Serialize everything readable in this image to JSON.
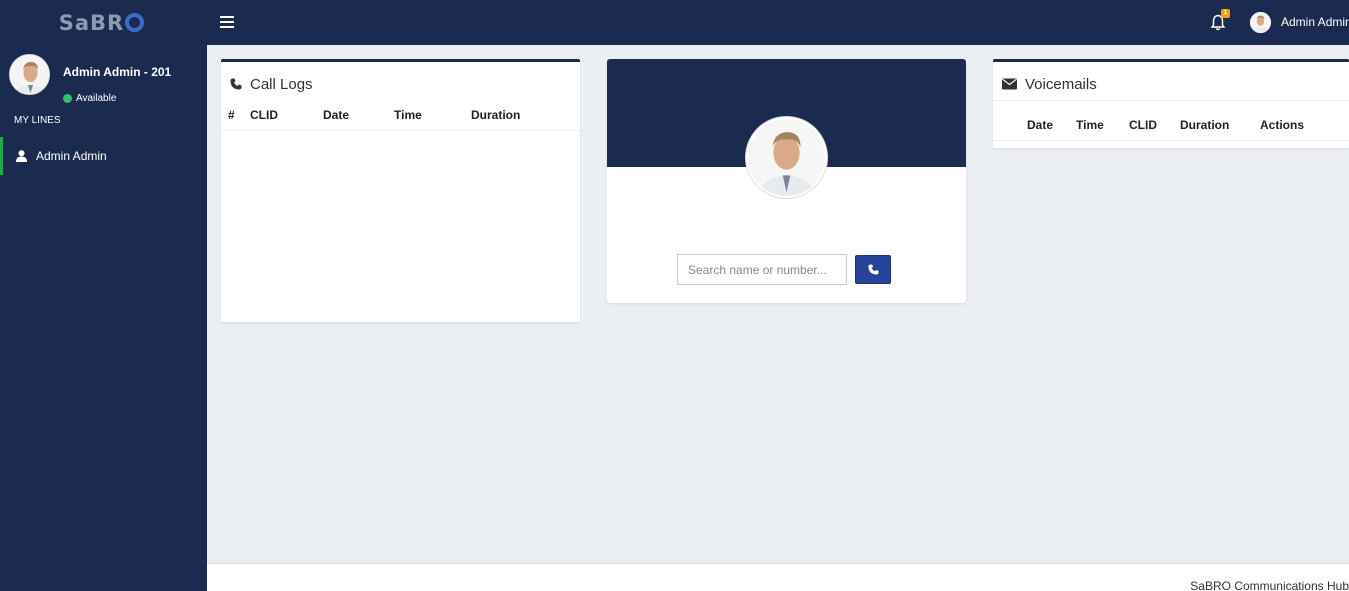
{
  "brand": {
    "logo_text": "SaBR"
  },
  "sidebar": {
    "user_name": "Admin Admin - 201",
    "status": "Available",
    "lines_header": "MY LINES",
    "lines": [
      {
        "label": "Admin Admin"
      }
    ]
  },
  "topbar": {
    "notification_count": "1",
    "user_name": "Admin Admin"
  },
  "call_logs": {
    "title": "Call Logs",
    "columns": [
      "#",
      "CLID",
      "Date",
      "Time",
      "Duration"
    ]
  },
  "dialer": {
    "search_placeholder": "Search name or number..."
  },
  "voicemails": {
    "title": "Voicemails",
    "columns": [
      "Date",
      "Time",
      "CLID",
      "Duration",
      "Actions"
    ]
  },
  "footer": {
    "text": "SaBRO Communications Hub"
  },
  "colors": {
    "nav": "#1b2b4f",
    "accent": "#27449a",
    "status_available": "#28c76f",
    "active_line": "#1ea94b",
    "badge": "#f0a400"
  }
}
